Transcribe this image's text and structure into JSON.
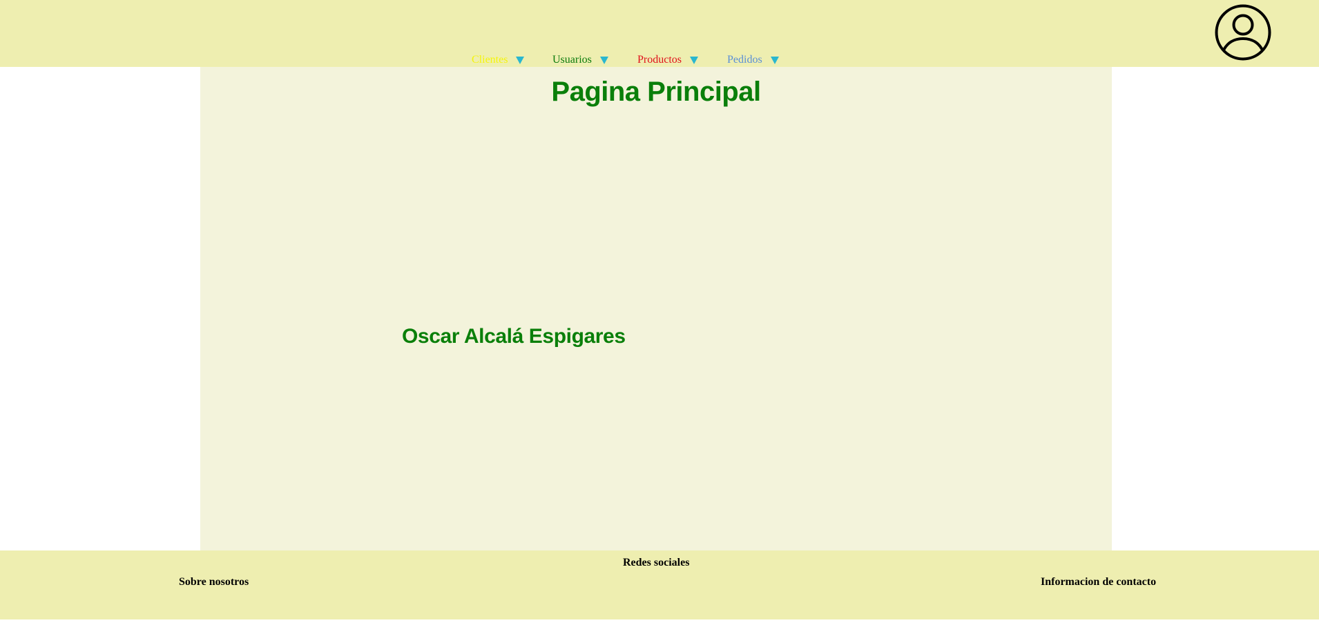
{
  "header": {
    "nav": [
      {
        "label": "Clientes",
        "color": "#f5f50a"
      },
      {
        "label": "Usuarios",
        "color": "#0a7a0a"
      },
      {
        "label": "Productos",
        "color": "#e0101a"
      },
      {
        "label": "Pedidos",
        "color": "#5a8fd6"
      }
    ],
    "caret_icon": "triangle-down-icon",
    "caret_color": "#2ab7cf",
    "avatar_icon": "user-circle-icon"
  },
  "main": {
    "title": "Pagina Principal",
    "author": "Oscar Alcalá Espigares"
  },
  "footer": {
    "social": "Redes sociales",
    "about": "Sobre nosotros",
    "contact": "Informacion de contacto"
  },
  "colors": {
    "header_bg": "#eeeeb0",
    "content_bg": "#f3f3db",
    "heading": "#0a7f0a"
  }
}
